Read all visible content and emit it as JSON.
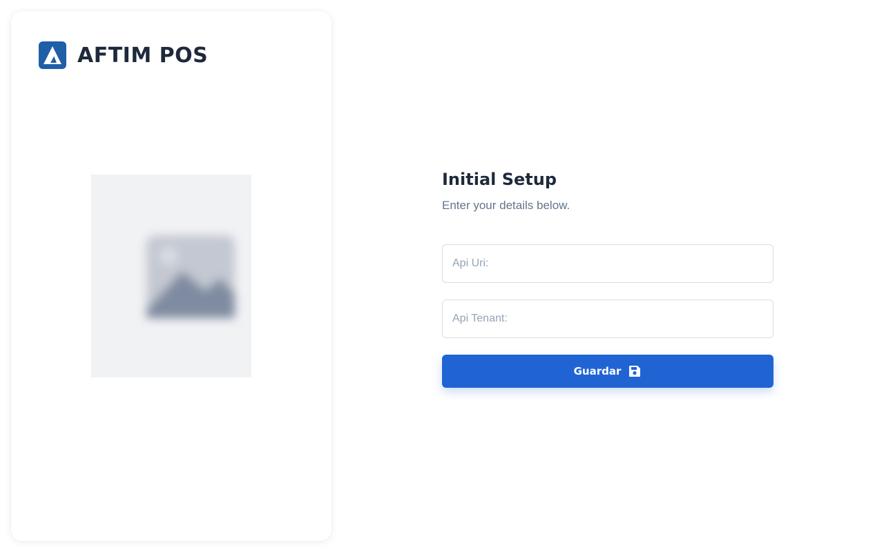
{
  "brand": {
    "name": "AFTIM POS",
    "logo_icon": "aftim-logo-icon",
    "logo_color": "#1f5fa8"
  },
  "illustration": {
    "icon": "image-placeholder-icon"
  },
  "setup": {
    "title": "Initial Setup",
    "subtitle": "Enter your details below.",
    "api_uri": {
      "placeholder": "Api Uri:",
      "value": ""
    },
    "api_tenant": {
      "placeholder": "Api Tenant:",
      "value": ""
    },
    "save_button": {
      "label": "Guardar",
      "icon": "floppy-disk-icon",
      "color": "#2064d4"
    }
  }
}
